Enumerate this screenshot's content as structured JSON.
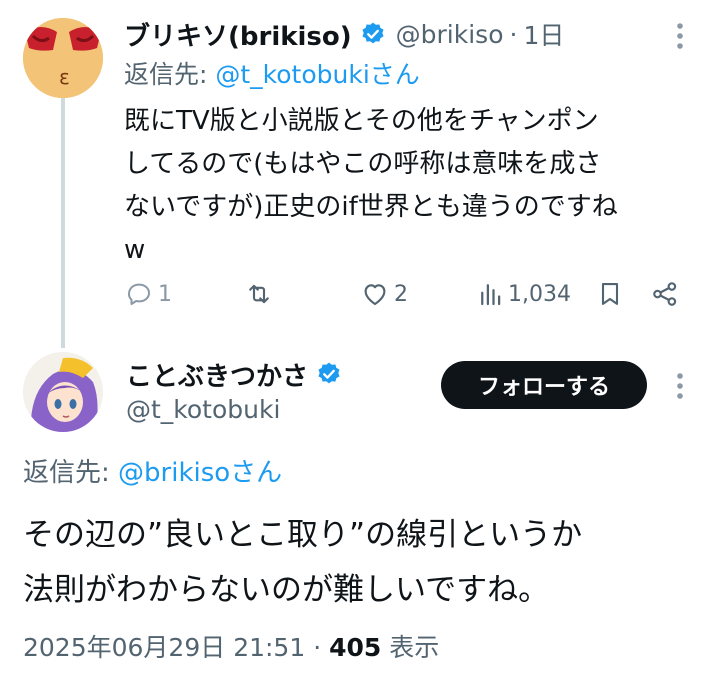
{
  "tweet1": {
    "display_name": "ブリキソ(brikiso)",
    "handle": "@brikiso",
    "separator": "·",
    "time": "1日",
    "reply_prefix": "返信先: ",
    "reply_mention": "@t_kotobukiさん",
    "text_lines": [
      "既にTV版と小説版とその他をチャンポン",
      "してるので(もはやこの呼称は意味を成さ",
      "ないですが)正史のif世界とも違うのですね",
      "w"
    ],
    "actions": {
      "replies": "1",
      "reposts": "",
      "likes": "2",
      "views": "1,034"
    },
    "avatar_icon": "red-cartoon-avatar",
    "more_icon": "more-vertical-icon"
  },
  "tweet2": {
    "display_name": "ことぶきつかさ",
    "handle": "@t_kotobuki",
    "follow_label": "フォローする",
    "reply_prefix": "返信先: ",
    "reply_mention": "@brikisoさん",
    "text_lines": [
      "その辺の”良いとこ取り”の線引というか",
      "法則がわからないのが難しいですね。"
    ],
    "date": "2025年06月29日 21:51",
    "separator": "·",
    "views_count": "405",
    "views_label": " 表示",
    "avatar_icon": "anime-character-avatar"
  },
  "colors": {
    "accent": "#1d9bf0",
    "text": "#0f1419",
    "secondary": "#536471",
    "thread_line": "#cfd9de",
    "follow_bg": "#0f1419"
  }
}
